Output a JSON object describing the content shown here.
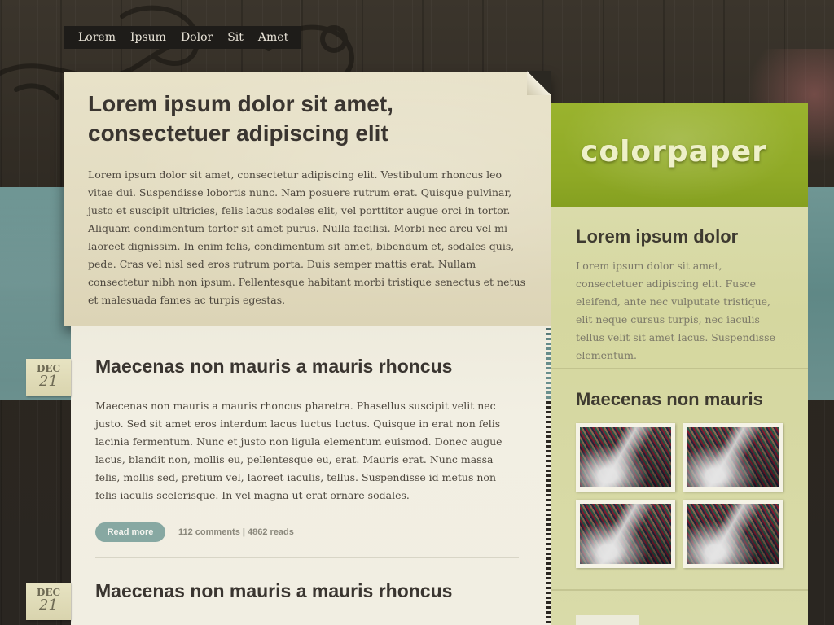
{
  "nav": {
    "items": [
      "Lorem",
      "Ipsum",
      "Dolor",
      "Sit",
      "Amet"
    ]
  },
  "hero": {
    "title": "Lorem ipsum dolor sit amet, consectetuer adipiscing elit",
    "body": "Lorem ipsum dolor sit amet, consectetur adipiscing elit. Vestibulum rhoncus leo vitae dui. Suspendisse lobortis nunc. Nam posuere rutrum erat. Quisque pulvinar, justo et suscipit ultricies, felis lacus sodales elit, vel porttitor augue orci in tortor. Aliquam condimentum tortor sit amet purus. Nulla facilisi. Morbi nec arcu vel mi laoreet dignissim. In enim felis, condimentum sit amet, bibendum et, sodales quis, pede. Cras vel nisl sed eros rutrum porta. Duis semper mattis erat. Nullam consectetur nibh non ipsum. Pellentesque habitant morbi tristique senectus et netus et malesuada fames ac turpis egestas."
  },
  "posts": [
    {
      "date_month": "DEC",
      "date_day": "21",
      "title": "Maecenas non mauris a mauris rhoncus",
      "body": "Maecenas non mauris a mauris rhoncus pharetra. Phasellus suscipit velit nec justo. Sed sit amet eros interdum lacus luctus luctus. Quisque in erat non felis lacinia fermentum. Nunc et justo non ligula elementum euismod. Donec augue lacus, blandit non, mollis eu, pellentesque eu, erat. Mauris erat. Nunc massa felis, mollis sed, pretium vel, laoreet iaculis, tellus. Suspendisse id metus non felis iaculis scelerisque. In vel magna ut erat ornare sodales.",
      "read_more": "Read more",
      "meta": "112 comments  |  4862 reads"
    },
    {
      "date_month": "DEC",
      "date_day": "21",
      "title": "Maecenas non mauris a mauris rhoncus"
    }
  ],
  "sidebar": {
    "brand": "colorpaper",
    "block1": {
      "title": "Lorem ipsum dolor",
      "body": "Lorem ipsum dolor sit amet, consectetuer adipiscing elit. Fusce eleifend, ante nec vulputate tristique, elit neque cursus turpis, nec iaculis tellus velit sit amet lacus. Suspendisse elementum."
    },
    "block2": {
      "title": "Maecenas non mauris",
      "thumbs": [
        "thumbnail-1",
        "thumbnail-2",
        "thumbnail-3",
        "thumbnail-4"
      ]
    }
  },
  "colors": {
    "brand_green": "#9ab32e",
    "read_more_teal": "#87a8a2",
    "paper": "#e8e2c9"
  }
}
